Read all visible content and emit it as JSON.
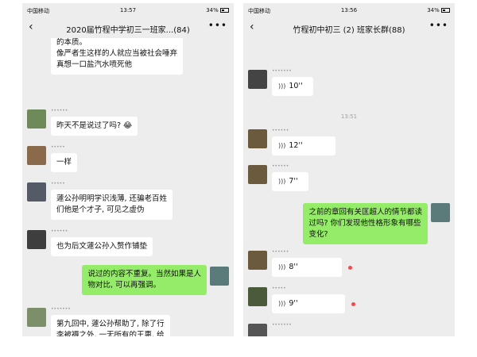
{
  "left": {
    "status": {
      "carrier": "中国移动",
      "time": "13:57",
      "battery": "34%"
    },
    "title": "2020届竹程中学初三一班家...(84)",
    "messages": [
      {
        "kind": "text",
        "text": "的本质。\n像严者生这样的人就应当被社会唾弃\n真想一口盐汽水喷死他"
      },
      {
        "kind": "text",
        "text": "昨天不是说过了吗? 😂"
      },
      {
        "kind": "text",
        "text": "一样"
      },
      {
        "kind": "text",
        "text": "蘧公孙明明学识浅薄, 还骗老百姓\n们他是个才子, 可见之虚伪"
      },
      {
        "kind": "text",
        "text": "也为后文蘧公孙入赘作铺垫"
      },
      {
        "kind": "text",
        "text": "说过的内容不重复。当然如果是人\n物对比, 可以再强调。"
      },
      {
        "kind": "text",
        "text": "第九回中, 蘧公孙帮助了, 除了行\n李被褥之外, 一无所有的王惠, 给"
      }
    ]
  },
  "right": {
    "status": {
      "carrier": "中国移动",
      "time": "13:56",
      "battery": "34%"
    },
    "title": "竹程初中初三 (2) 班家长群(88)",
    "timestamp": "13:51",
    "voices": [
      "10''",
      "12''",
      "7''",
      "8''",
      "9''"
    ],
    "question": "之前的章回有关匡超人的情节都读\n过吗? 你们发现他性格形象有哪些\n变化?"
  },
  "colors": {
    "bubble_self": "#95ec69",
    "bubble_other": "#ffffff",
    "chat_bg": "#ededed",
    "unread_dot": "#f24a4a"
  }
}
